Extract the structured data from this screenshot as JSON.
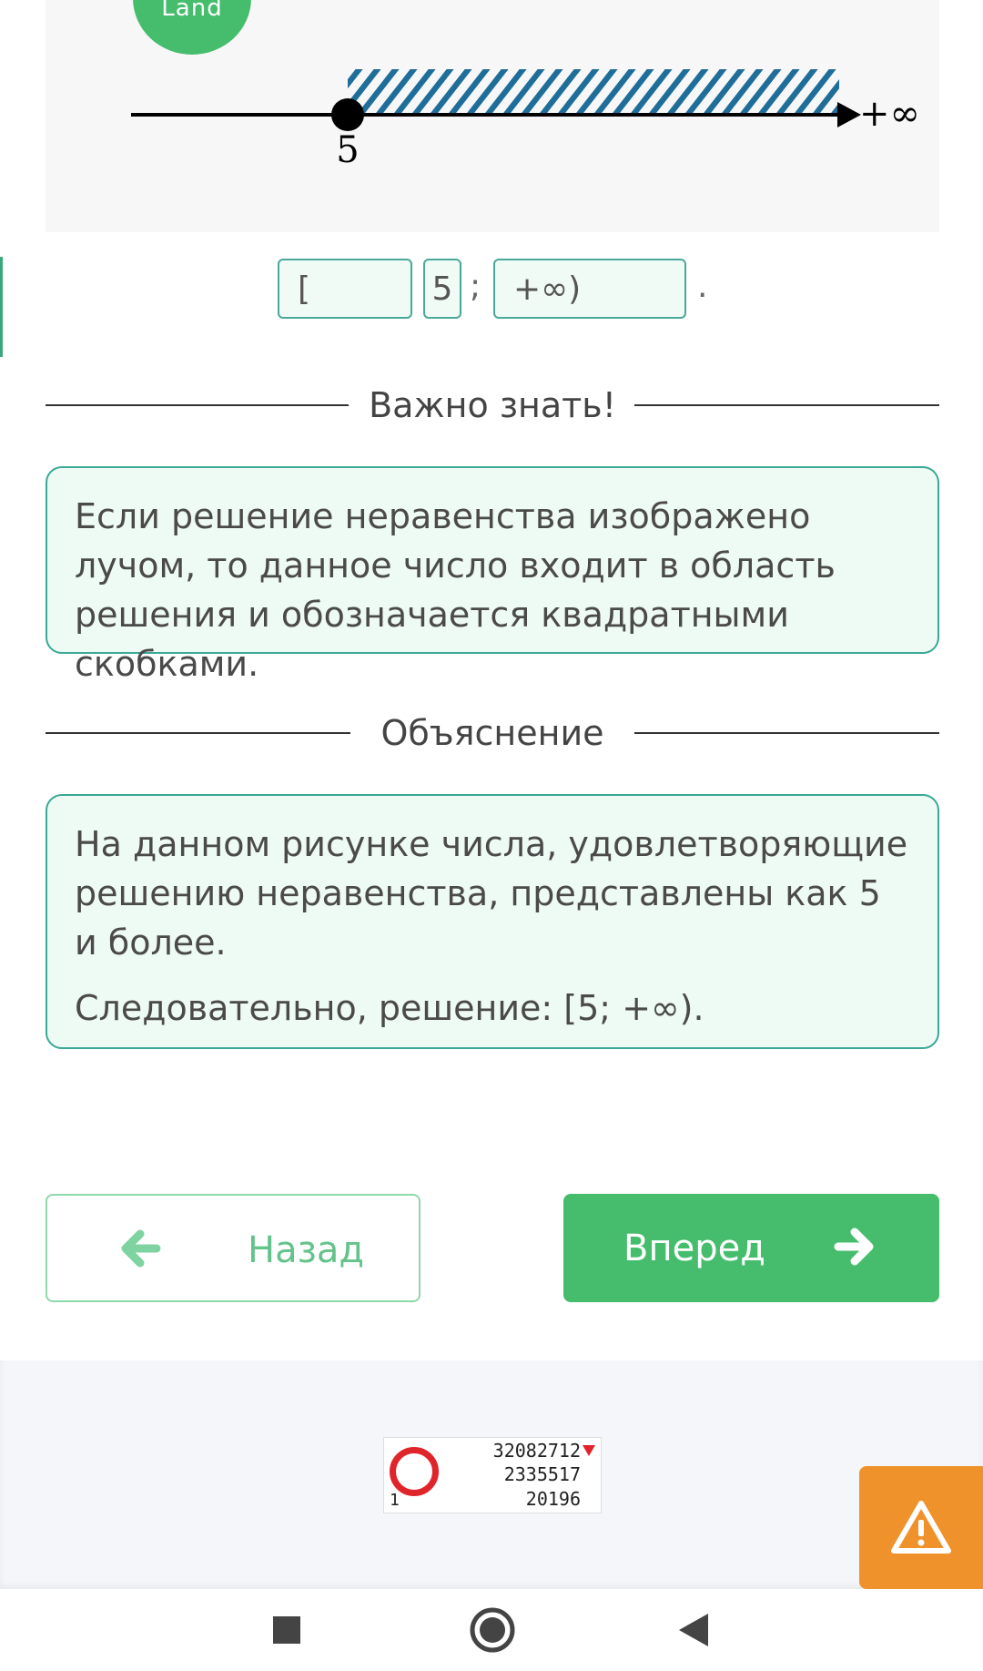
{
  "logo": {
    "text": "Land"
  },
  "number_line": {
    "point_label": "5",
    "end_label": "+∞"
  },
  "answer": {
    "bracket_open": "[",
    "value": "5",
    "separator": ";",
    "upper": "+∞)",
    "period": "."
  },
  "important": {
    "heading": "Важно знать!",
    "text": "Если решение неравенства изображено лучом, то данное число входит в область решения и обозначается квадратными скобками."
  },
  "explanation": {
    "heading": "Объяснение",
    "paragraph1": "На данном рисунке числа, удовлетворяющие решению неравенства, представлены как 5 и более.",
    "paragraph2": "Следовательно, решение: [5; +∞)."
  },
  "nav": {
    "back_label": "Назад",
    "next_label": "Вперед"
  },
  "counter": {
    "line1": "32082712",
    "line2": "2335517",
    "line3": "20196",
    "index": "1"
  },
  "colors": {
    "accent_green": "#46bd6d",
    "box_border": "#3aa895",
    "box_bg": "#eefaf4",
    "warning_orange": "#f0922b",
    "hatch_blue": "#1f6e9a"
  },
  "icons": {
    "back": "arrow-left-icon",
    "next": "arrow-right-icon",
    "warning": "warning-icon",
    "sys_recents": "square-icon",
    "sys_home": "circle-icon",
    "sys_back": "triangle-left-icon"
  }
}
